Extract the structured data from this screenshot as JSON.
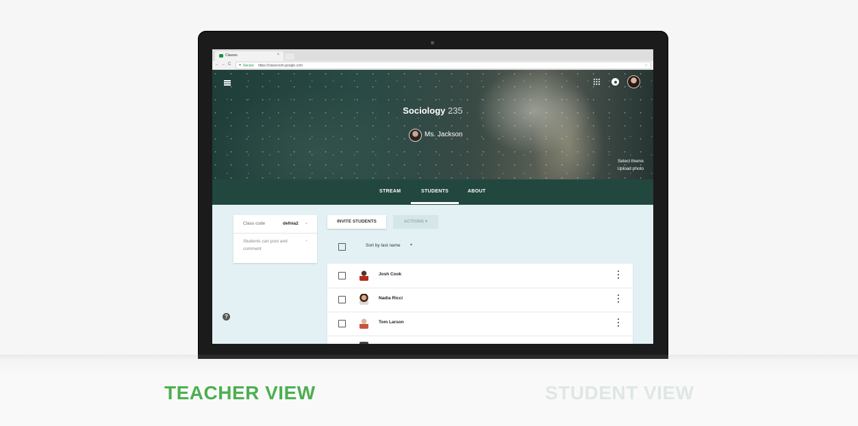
{
  "browser": {
    "tab_title": "Classes",
    "tab_close": "×",
    "nav_back": "←",
    "nav_forward": "→",
    "nav_reload": "C",
    "secure_label": "Secure",
    "url": "https://classroom.google.com",
    "bookmark_icon": "☆"
  },
  "header": {
    "class_name": "Sociology",
    "class_section": "235",
    "teacher_name": "Ms. Jackson",
    "select_theme": "Select theme",
    "upload_photo": "Upload photo"
  },
  "tabs": [
    {
      "label": "STREAM"
    },
    {
      "label": "STUDENTS",
      "active": true
    },
    {
      "label": "ABOUT"
    }
  ],
  "sidebar": {
    "class_code_label": "Class code",
    "class_code_value": "defnia2",
    "permission_text": "Students can post and comment",
    "caret": "⌄",
    "help": "?"
  },
  "toolbar": {
    "invite_label": "INVITE STUDENTS",
    "actions_label": "ACTIONS ▾",
    "sort_label": "Sort by last name",
    "sort_caret": "▾"
  },
  "students": [
    {
      "name": "Josh Cook"
    },
    {
      "name": "Nadia Ricci"
    },
    {
      "name": "Tom Larson"
    }
  ],
  "captions": {
    "teacher_view": "TEACHER VIEW",
    "student_view": "STUDENT VIEW"
  },
  "colors": {
    "tabs_bar": "#22473f",
    "content_bg": "#e3f1f4",
    "teacher_caption": "#4caf50",
    "student_caption": "#dfe7e3"
  }
}
